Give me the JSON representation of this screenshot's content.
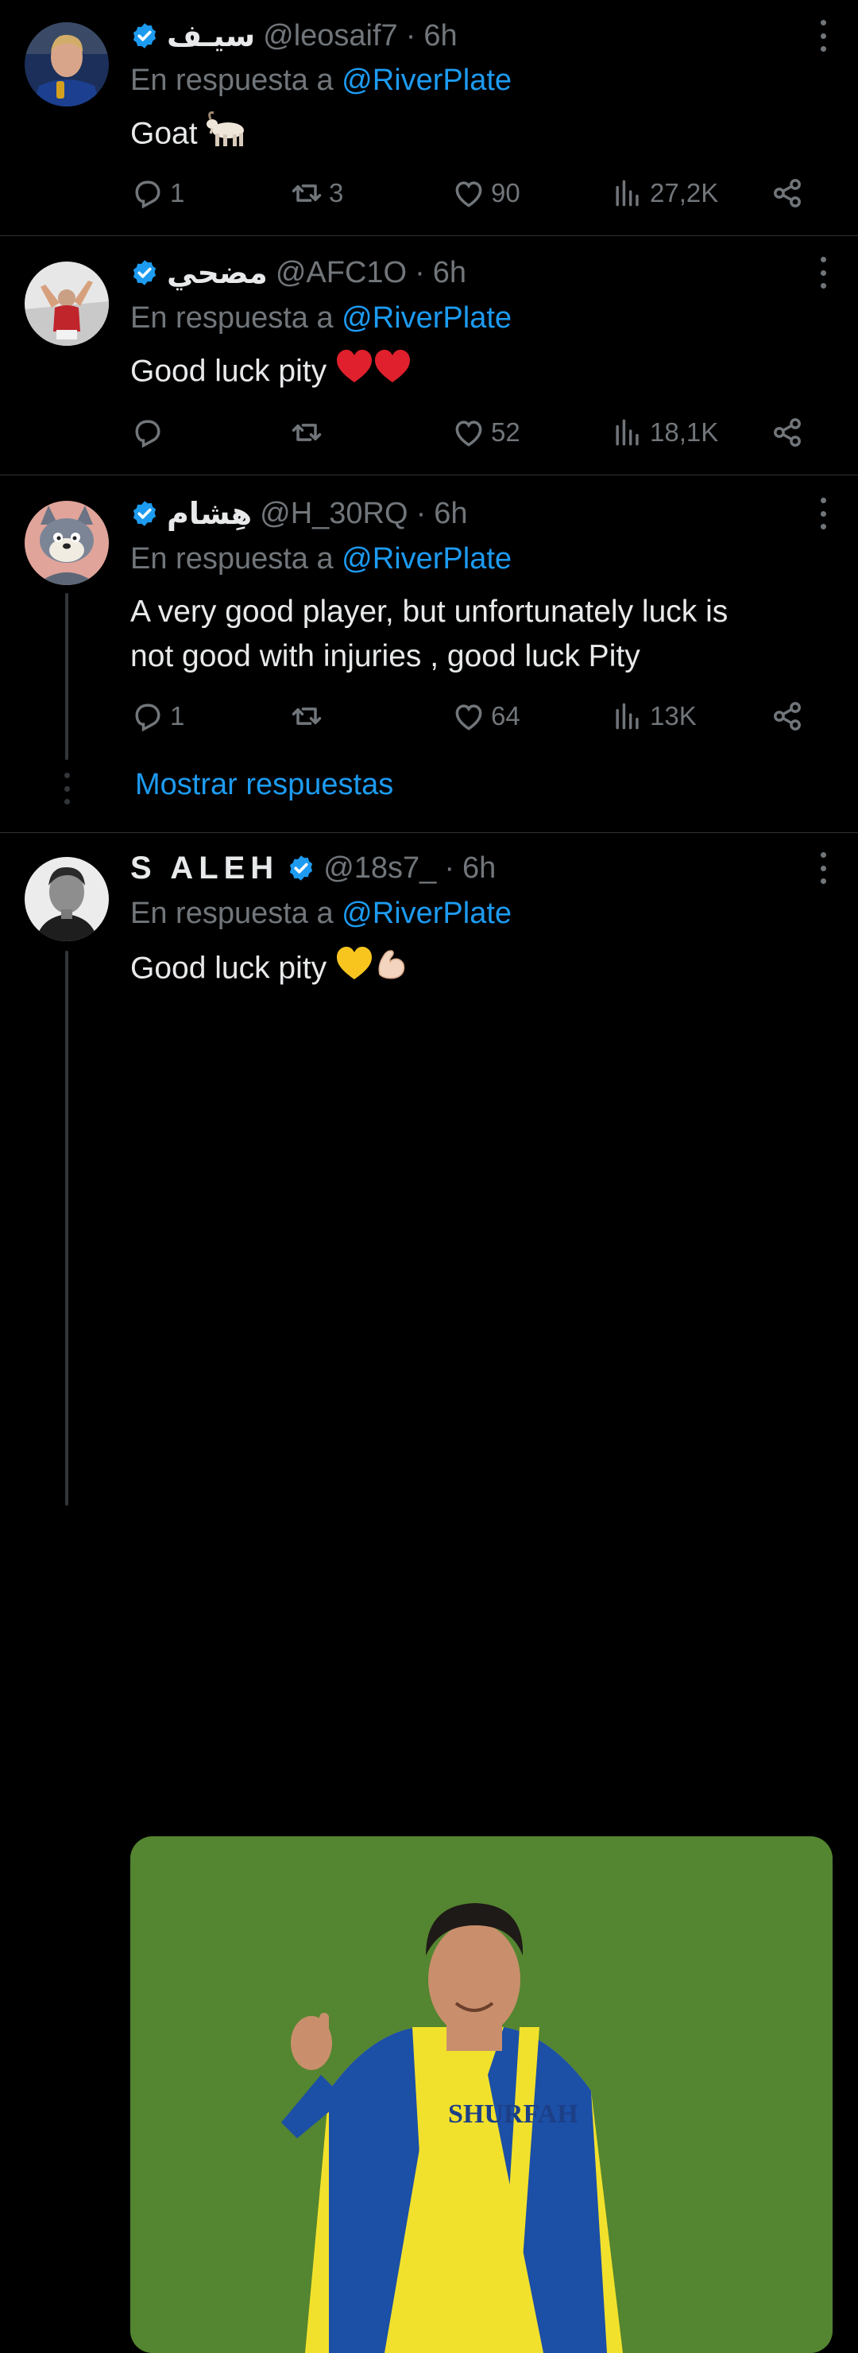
{
  "tweets": [
    {
      "name": "سيـف",
      "handle": "@leosaif7",
      "separator": "·",
      "time": "6h",
      "reply_prefix": "En respuesta a",
      "reply_to": "@RiverPlate",
      "text": "Goat",
      "emoji": "goat",
      "replies": "1",
      "retweets": "3",
      "likes": "90",
      "views": "27,2K"
    },
    {
      "name": "مضحي",
      "handle": "@AFC1O",
      "separator": "·",
      "time": "6h",
      "reply_prefix": "En respuesta a",
      "reply_to": "@RiverPlate",
      "text": "Good luck pity",
      "emoji": "two-red-hearts",
      "replies": "",
      "retweets": "",
      "likes": "52",
      "views": "18,1K"
    },
    {
      "name": "هِشام",
      "handle": "@H_30RQ",
      "separator": "·",
      "time": "6h",
      "reply_prefix": "En respuesta a",
      "reply_to": "@RiverPlate",
      "text_line1": "A very good player, but unfortunately luck is",
      "text_line2": "not good with injuries , good luck Pity",
      "replies": "1",
      "retweets": "",
      "likes": "64",
      "views": "13K",
      "show_replies": "Mostrar respuestas"
    },
    {
      "name": "S ALEH",
      "handle": "@18s7_",
      "separator": "·",
      "time": "6h",
      "reply_prefix": "En respuesta a",
      "reply_to": "@RiverPlate",
      "text": "Good luck pity",
      "emoji": "yellow-heart-flexed-bicep",
      "media_shirt_text": "SHURFAH"
    }
  ],
  "colors": {
    "background": "#000000",
    "text": "#e7e9ea",
    "muted": "#71767b",
    "link": "#1d9bf0",
    "divider": "#2f3336"
  }
}
